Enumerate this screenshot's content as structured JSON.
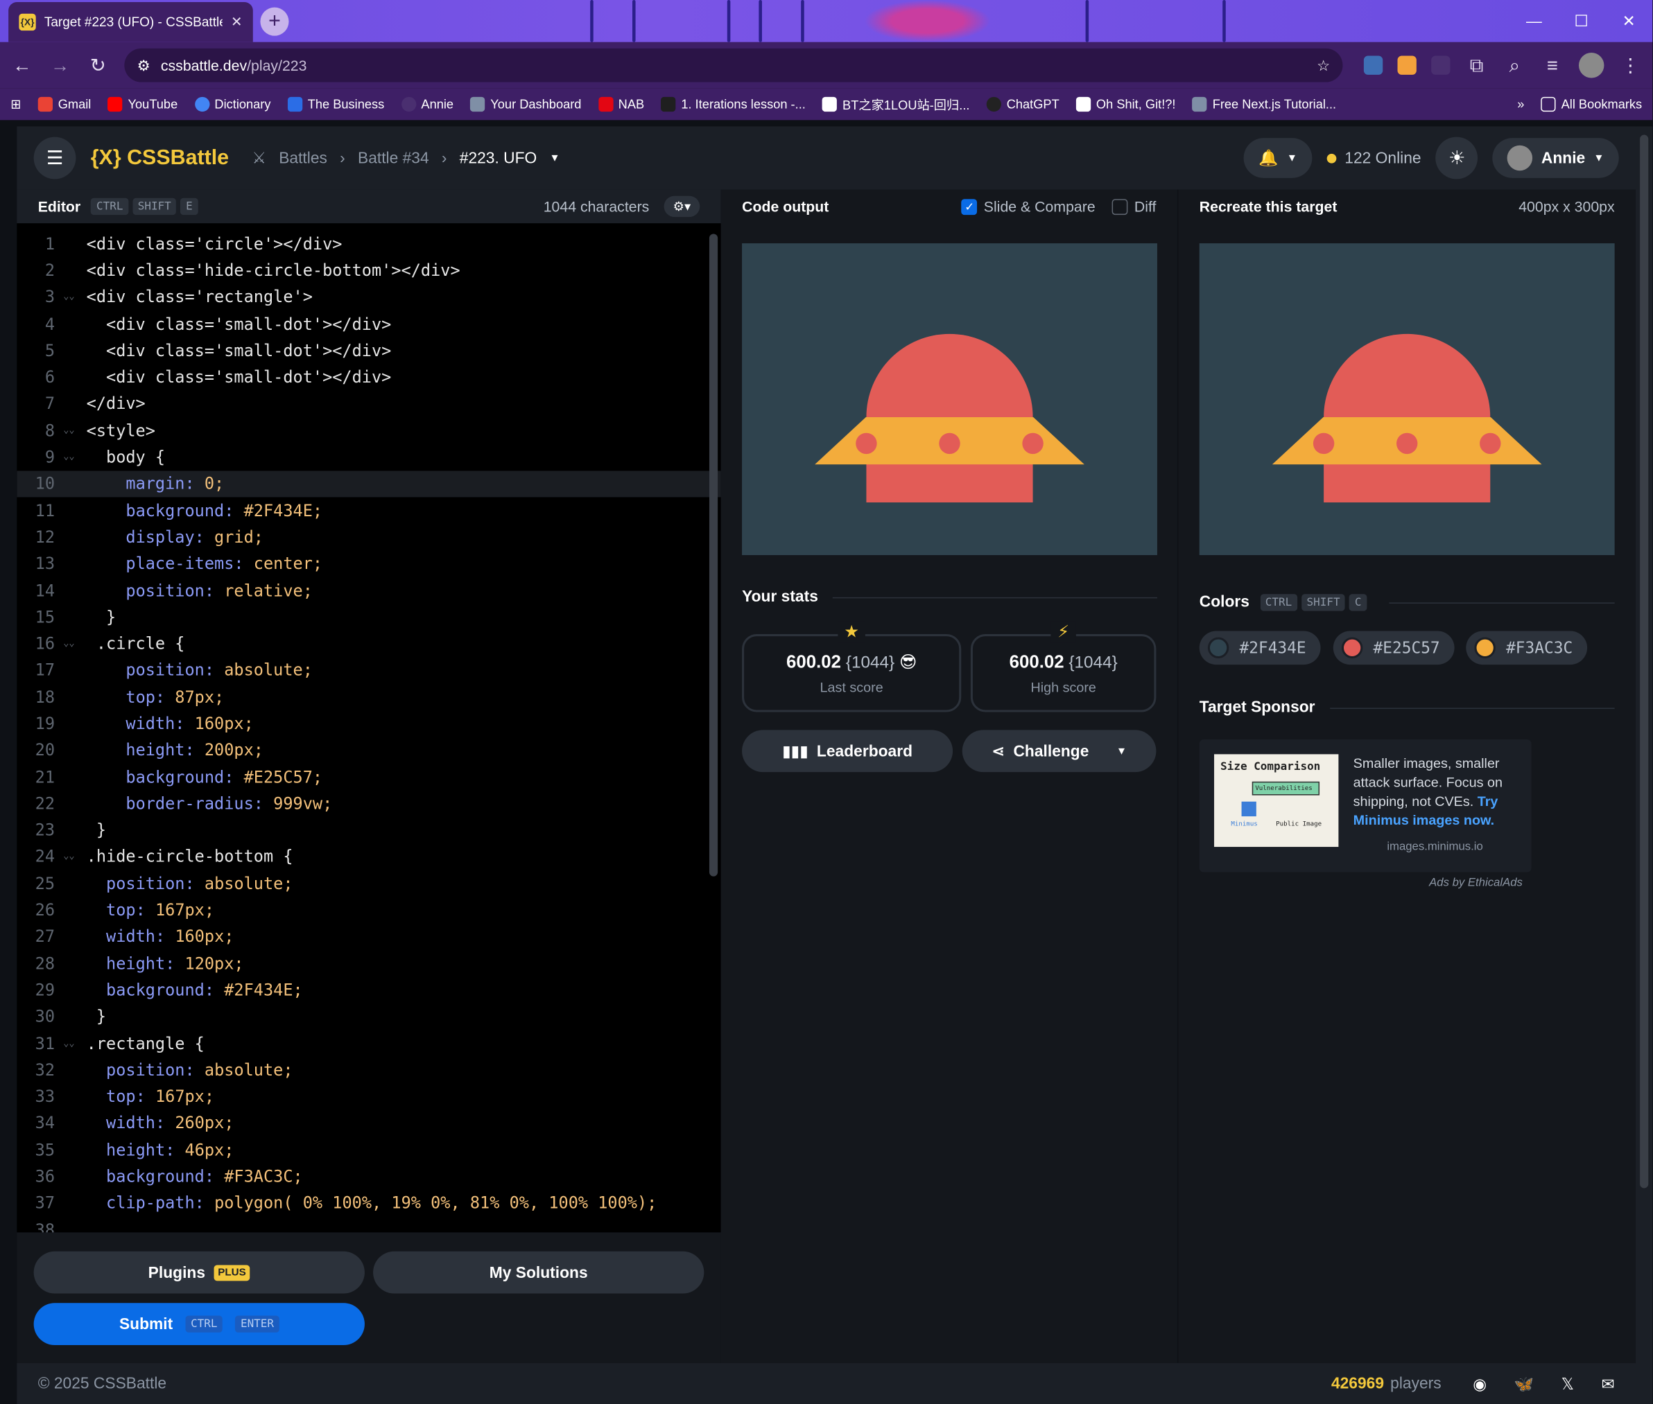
{
  "browser": {
    "tab_title": "Target #223 (UFO) - CSSBattle",
    "tab_icon": "{X}",
    "url_host": "cssbattle.dev",
    "url_path": "/play/223",
    "bookmarks": [
      "Gmail",
      "YouTube",
      "Dictionary",
      "The Business",
      "Annie",
      "Your Dashboard",
      "NAB",
      "1. Iterations lesson -...",
      "BT之家1LOU站-回归...",
      "ChatGPT",
      "Oh Shit, Git!?!",
      "Free Next.js Tutorial..."
    ],
    "all_bookmarks": "All Bookmarks"
  },
  "header": {
    "logo": "{X} CSSBattle",
    "crumb_battles": "Battles",
    "crumb_battle": "Battle #34",
    "crumb_target": "#223. UFO",
    "online": "122 Online",
    "user": "Annie"
  },
  "editor": {
    "title": "Editor",
    "kbd": [
      "CTRL",
      "SHIFT",
      "E"
    ],
    "chars": "1044 characters",
    "lines": [
      "<div class='circle'></div>",
      "<div class='hide-circle-bottom'></div>",
      "<div class='rectangle'>",
      "  <div class='small-dot'></div>",
      "  <div class='small-dot'></div>",
      "  <div class='small-dot'></div>",
      "</div>",
      "<style>",
      "  body {",
      "    margin: 0;",
      "    background: #2F434E;",
      "    display: grid;",
      "    place-items: center;",
      "    position: relative;",
      "  }",
      " .circle {",
      "    position: absolute;",
      "    top: 87px;",
      "    width: 160px;",
      "    height: 200px;",
      "    background: #E25C57;",
      "    border-radius: 999vw;",
      " }",
      ".hide-circle-bottom {",
      "  position: absolute;",
      "  top: 167px;",
      "  width: 160px;",
      "  height: 120px;",
      "  background: #2F434E;",
      " }",
      ".rectangle {",
      "  position: absolute;",
      "  top: 167px;",
      "  width: 260px;",
      "  height: 46px;",
      "  background: #F3AC3C;",
      "  clip-path: polygon( 0% 100%, 19% 0%, 81% 0%, 100% 100%);",
      ""
    ]
  },
  "editor_footer": {
    "plugins": "Plugins",
    "plus": "PLUS",
    "solutions": "My Solutions",
    "submit": "Submit",
    "submit_kbd": [
      "CTRL",
      "ENTER"
    ]
  },
  "output": {
    "title": "Code output",
    "slide": "Slide & Compare",
    "diff": "Diff",
    "stats_title": "Your stats",
    "last_score": "600.02",
    "last_chars": "{1044}",
    "last_label": "Last score",
    "high_score": "600.02",
    "high_chars": "{1044}",
    "high_label": "High score",
    "leaderboard": "Leaderboard",
    "challenge": "Challenge"
  },
  "target": {
    "title": "Recreate this target",
    "size": "400px x 300px",
    "colors_title": "Colors",
    "colors_kbd": [
      "CTRL",
      "SHIFT",
      "C"
    ],
    "colors": [
      {
        "hex": "#2F434E",
        "label": "#2F434E"
      },
      {
        "hex": "#E25C57",
        "label": "#E25C57"
      },
      {
        "hex": "#F3AC3C",
        "label": "#F3AC3C"
      }
    ],
    "sponsor_title": "Target Sponsor",
    "ad_heading": "Size Comparison",
    "ad_badge": "Vulnerabilities",
    "ad_label_a": "Minimus",
    "ad_label_b": "Public Image",
    "ad_text": "Smaller images, smaller attack surface. Focus on shipping, not CVEs.",
    "ad_link": "Try Minimus images now.",
    "ad_domain": "images.minimus.io",
    "ad_by": "Ads by EthicalAds"
  },
  "footer": {
    "copyright": "© 2025 CSSBattle",
    "players_count": "426969",
    "players_label": "players"
  }
}
